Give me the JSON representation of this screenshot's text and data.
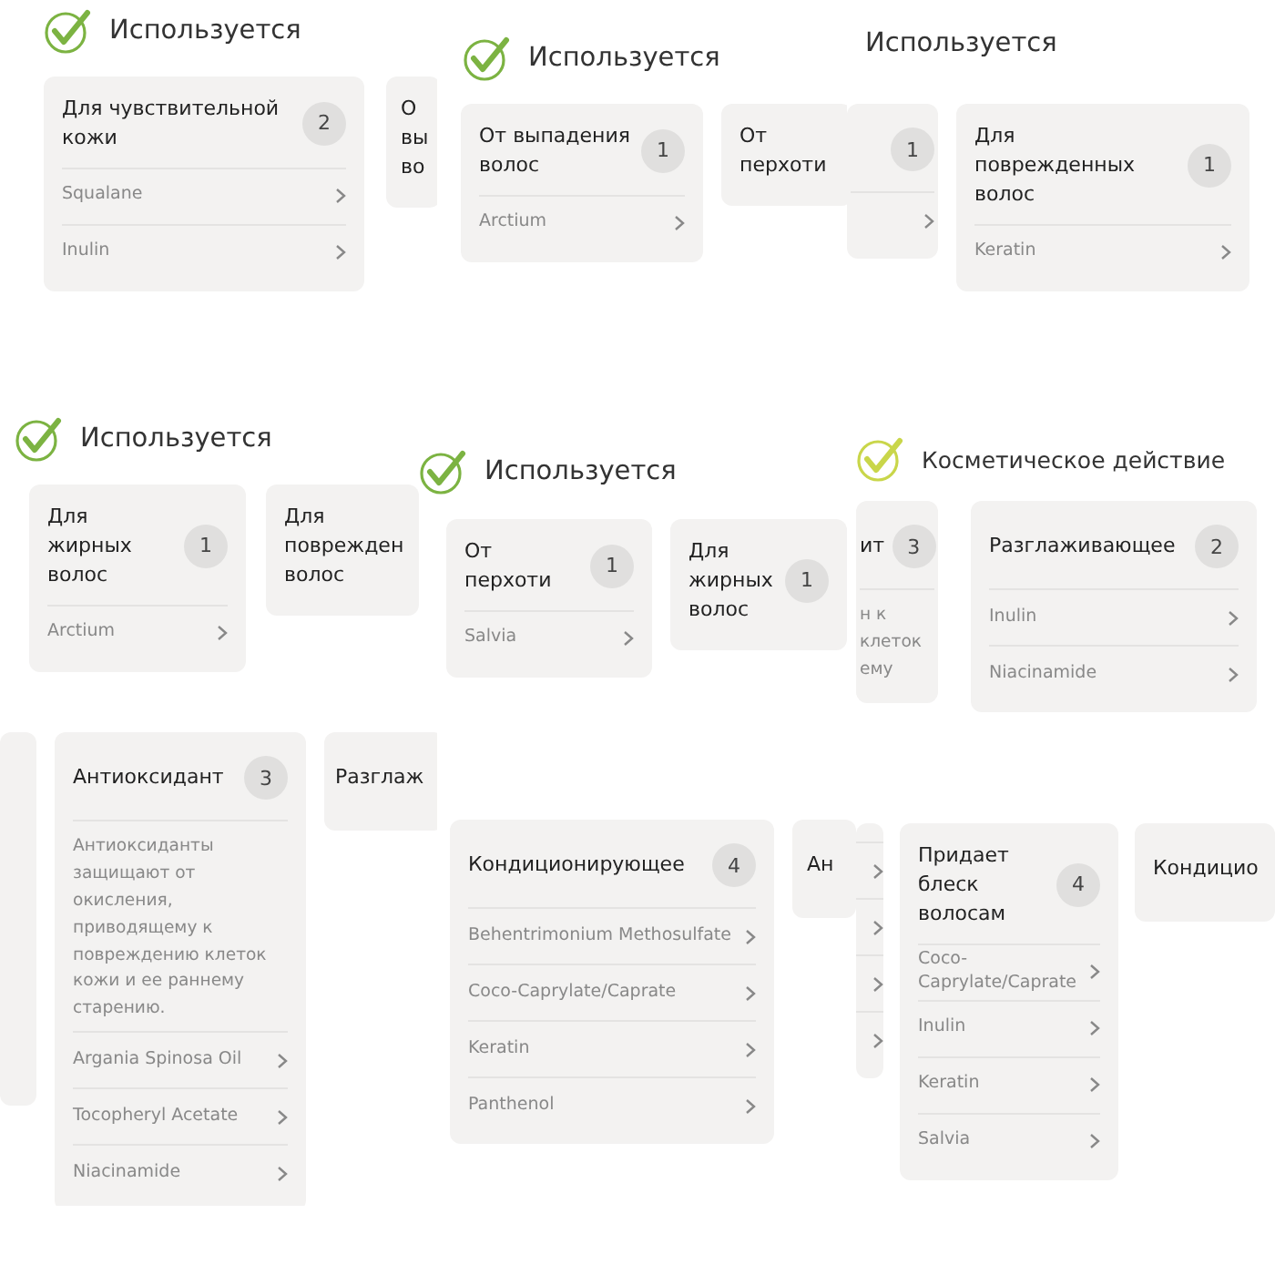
{
  "fragments": [
    {
      "header": {
        "title": "Используется",
        "check": {
          "color": "#7cb342"
        }
      },
      "cards": [
        {
          "title": "Для чувствительной кожи",
          "badge": "2",
          "items": [
            {
              "name": "Squalane"
            },
            {
              "name": "Inulin"
            }
          ]
        },
        {
          "lines": [
            "О",
            "вы",
            "во"
          ]
        }
      ]
    },
    {
      "header": {
        "title": "Используется",
        "check": {
          "color": "#7cb342"
        }
      },
      "cards": [
        {
          "title": "От выпадения волос",
          "badge": "1",
          "items": [
            {
              "name": "Arctium"
            }
          ]
        },
        {
          "title": "От перхоти"
        }
      ]
    },
    {
      "header": {
        "title": "Используется"
      },
      "cards": [
        {
          "badge": "1",
          "items": [
            {
              "kind": "chevron-only"
            }
          ]
        },
        {
          "title": "Для поврежденных волос",
          "badge": "1",
          "items": [
            {
              "name": "Keratin"
            }
          ]
        }
      ]
    },
    {
      "header": {
        "title": "Используется",
        "check": {
          "color": "#7cb342"
        }
      },
      "cards": [
        {
          "title": "Для жирных волос",
          "badge": "1",
          "items": [
            {
              "name": "Arctium"
            }
          ]
        },
        {
          "lines": [
            "Для",
            "поврежден",
            "волос"
          ]
        }
      ]
    },
    {
      "header": {
        "title": "Используется",
        "check": {
          "color": "#7cb342"
        }
      },
      "cards": [
        {
          "title": "От перхоти",
          "badge": "1",
          "items": [
            {
              "name": "Salvia"
            }
          ]
        },
        {
          "title": "Для жирных волос",
          "badge": "1"
        }
      ]
    },
    {
      "header": {
        "title": "Косметическое действие",
        "check": {
          "color": "#c9d64a"
        }
      },
      "cards": [
        {
          "lines": [
            "ит"
          ],
          "badge": "3",
          "description": "н к клеток ему"
        },
        {
          "title": "Разглаживающее",
          "badge": "2",
          "items": [
            {
              "name": "Inulin"
            },
            {
              "name": "Niacinamide"
            }
          ]
        }
      ]
    },
    {
      "cards": [
        {
          "kind": "strip"
        },
        {
          "title": "Антиоксидант",
          "badge": "3",
          "description": "Антиоксиданты защищают от окисления, приводящему к повреждению клеток кожи и ее раннему старению.",
          "items": [
            {
              "name": "Argania Spinosa Oil"
            },
            {
              "name": "Tocopheryl Acetate"
            },
            {
              "name": "Niacinamide"
            }
          ]
        },
        {
          "lines": [
            "Разглаж"
          ]
        }
      ]
    },
    {
      "cards": [
        {
          "title": "Кондиционирующее",
          "badge": "4",
          "items": [
            {
              "name": "Behentrimonium Methosulfate"
            },
            {
              "name": "Coco-Caprylate/Caprate"
            },
            {
              "name": "Keratin"
            },
            {
              "name": "Panthenol"
            }
          ]
        },
        {
          "lines": [
            "Ан"
          ]
        }
      ]
    },
    {
      "cards": [
        {
          "items": [
            {
              "kind": "chevron-only"
            },
            {
              "kind": "chevron-only"
            },
            {
              "kind": "chevron-only"
            },
            {
              "kind": "chevron-only"
            }
          ]
        },
        {
          "title": "Придает блеск волосам",
          "badge": "4",
          "items": [
            {
              "name": "Coco-Caprylate/Caprate"
            },
            {
              "name": "Inulin"
            },
            {
              "name": "Keratin"
            },
            {
              "name": "Salvia"
            }
          ]
        },
        {
          "lines": [
            "Кондицио"
          ]
        }
      ]
    }
  ]
}
